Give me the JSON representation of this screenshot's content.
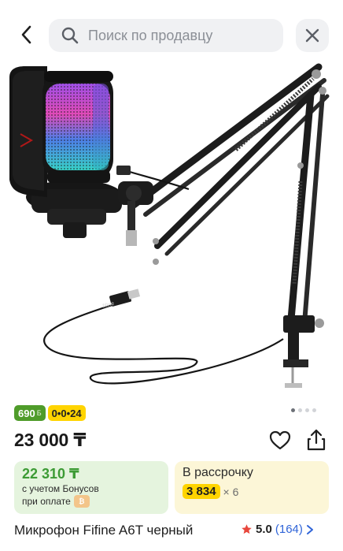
{
  "header": {
    "search_placeholder": "Поиск по продавцу"
  },
  "image": {
    "brand_label": "fifine"
  },
  "pager": {
    "total": 4,
    "active": 0
  },
  "badges": {
    "bonus_amount": "690",
    "bonus_suffix": "Б",
    "installment": "0•0•24"
  },
  "price": "23 000 ₸",
  "bonus_card": {
    "amount": "22 310 ₸",
    "line1": "с учетом Бонусов",
    "line2": "при оплате"
  },
  "installment_card": {
    "title": "В рассрочку",
    "amount": "3 834",
    "times": "× 6"
  },
  "product": {
    "title": "Микрофон Fifine A6T черный",
    "rating": "5.0",
    "reviews": "(164)"
  },
  "colors": {
    "green_badge": "#4f9c2a",
    "yellow_badge": "#ffd400",
    "bonus_green": "#3d9b35",
    "link_blue": "#2f64d8",
    "star_red": "#e8473c"
  }
}
